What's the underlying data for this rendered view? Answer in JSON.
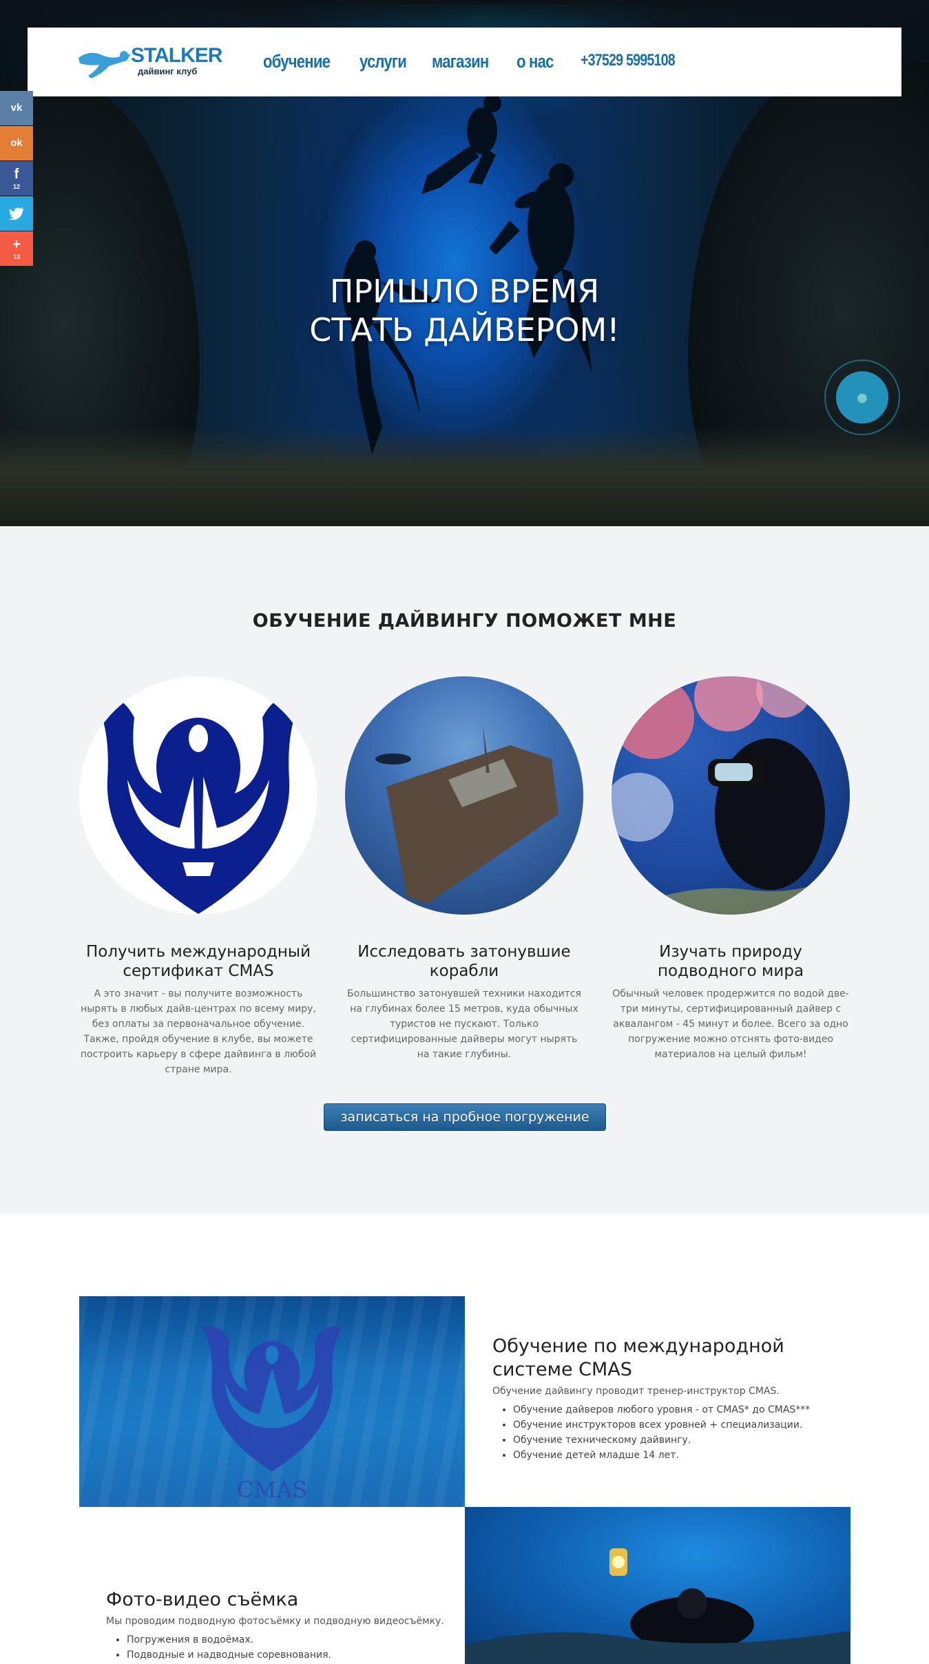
{
  "header": {
    "logo_title": "STALKER",
    "logo_subtitle": "дайвинг клуб",
    "nav": [
      "обучение",
      "услуги",
      "магазин",
      "о нас"
    ],
    "phone": "+37529 5995108"
  },
  "social": [
    {
      "icon": "vk-icon",
      "glyph": "vk",
      "color": "#5b7fa6",
      "count": ""
    },
    {
      "icon": "odnoklassniki-icon",
      "glyph": "ok",
      "color": "#e27e35",
      "count": ""
    },
    {
      "icon": "facebook-icon",
      "glyph": "f",
      "color": "#3b5998",
      "count": "12"
    },
    {
      "icon": "twitter-icon",
      "glyph": "t",
      "color": "#28a9e1",
      "count": ""
    },
    {
      "icon": "plus-icon",
      "glyph": "+",
      "color": "#f35b45",
      "count": "13"
    }
  ],
  "hero": {
    "title_line1": "ПРИШЛО ВРЕМЯ",
    "title_line2": "СТАТЬ ДАЙВЕРОМ!"
  },
  "benefits": {
    "title": "ОБУЧЕНИЕ ДАЙВИНГУ ПОМОЖЕТ МНЕ",
    "items": [
      {
        "title": "Получить международный сертификат CMAS",
        "text": "А это значит - вы получите возможность нырять в любых дайв-центрах по всему миру, без оплаты за первоначальное обучение.\nТакже, пройдя обучение в клубе, вы можете построить карьеру в сфере дайвинга в любой стране мира."
      },
      {
        "title": "Исследовать затонувшие корабли",
        "text": "Большинство затонувшей техники находится на глубинах более 15 метров, куда обычных туристов не пускают. Только сертифицированные дайверы могут нырять на такие глубины."
      },
      {
        "title": "Изучать природу подводного мира",
        "text": "Обычный человек продержится по водой две-три минуты, сертифицированный дайвер с аквалангом - 45 минут и более. Всего за одно погружение можно отснять фото-видео материалов на целый фильм!"
      }
    ],
    "cta": "записаться на пробное погружение"
  },
  "services": [
    {
      "title": "Обучение по международной системе CMAS",
      "intro": "Обучение дайвингу проводит тренер-инструктор CMAS.",
      "bullets": [
        "Обучение дайверов любого уровня - от CMAS* до CMAS***",
        "Обучение инструкторов всех уровней + специализации.",
        "Обучение техническому дайвингу.",
        "Обучение детей младше 14 лет."
      ],
      "image_caption": "CMAS"
    },
    {
      "title": "Фото-видео съёмка",
      "intro": "Мы проводим подводную фотосъёмку и подводную видеосъёмку.",
      "bullets": [
        "Погружения в водоёмах.",
        "Подводные и надводные соревнования."
      ]
    }
  ]
}
